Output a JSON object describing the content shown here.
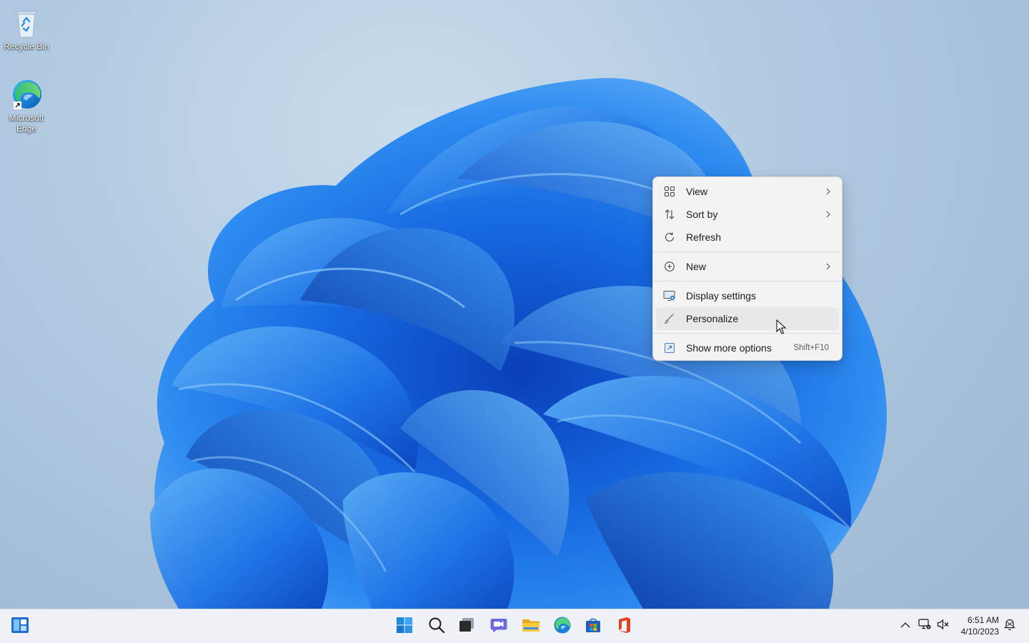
{
  "desktop": {
    "icons": [
      {
        "label": "Recycle Bin",
        "icon": "recycle-bin-icon"
      },
      {
        "label": "Microsoft Edge",
        "icon": "edge-icon"
      }
    ]
  },
  "context_menu": {
    "items": [
      {
        "label": "View",
        "icon": "grid-icon",
        "submenu": true
      },
      {
        "label": "Sort by",
        "icon": "sort-icon",
        "submenu": true
      },
      {
        "label": "Refresh",
        "icon": "refresh-icon",
        "submenu": false
      },
      {
        "label": "New",
        "icon": "plus-circle-icon",
        "submenu": true
      },
      {
        "label": "Display settings",
        "icon": "display-settings-icon",
        "submenu": false
      },
      {
        "label": "Personalize",
        "icon": "brush-icon",
        "submenu": false,
        "hovered": true
      },
      {
        "label": "Show more options",
        "icon": "show-more-icon",
        "shortcut": "Shift+F10"
      }
    ]
  },
  "taskbar": {
    "apps": [
      "widgets-icon",
      "start-icon",
      "search-icon",
      "task-view-icon",
      "chat-icon",
      "file-explorer-icon",
      "edge-icon",
      "store-icon",
      "office-icon"
    ],
    "tray": [
      "chevron-up-icon",
      "network-icon",
      "volume-muted-icon"
    ],
    "clock": {
      "time": "6:51 AM",
      "date": "4/10/2023"
    }
  },
  "colors": {
    "accent": "#0067c0",
    "menu_bg": "#f3f3f3",
    "taskbar_bg": "#eef1f6"
  }
}
